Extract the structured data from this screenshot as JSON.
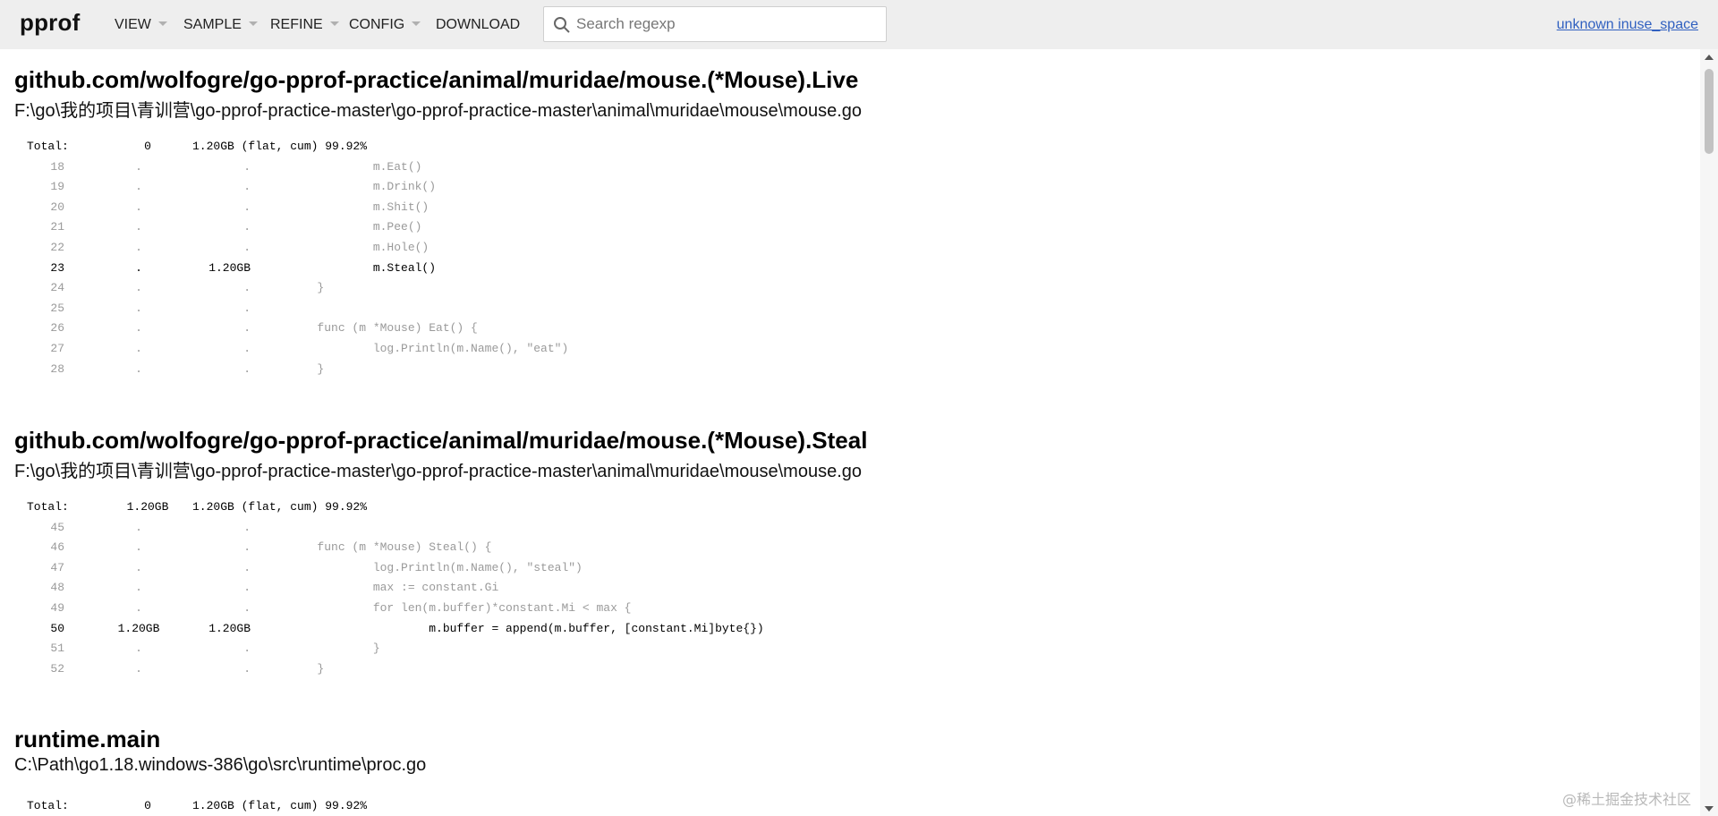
{
  "header": {
    "logo": "pprof",
    "menus": [
      {
        "label": "VIEW"
      },
      {
        "label": "SAMPLE"
      },
      {
        "label": "REFINE"
      },
      {
        "label": "CONFIG"
      },
      {
        "label": "DOWNLOAD"
      }
    ],
    "search_placeholder": "Search regexp",
    "search_value": "",
    "profile_link": "unknown inuse_space"
  },
  "sections": [
    {
      "title": "github.com/wolfogre/go-pprof-practice/animal/muridae/mouse.(*Mouse).Live",
      "path": "F:\\go\\我的项目\\青训营\\go-pprof-practice-master\\go-pprof-practice-master\\animal\\muridae\\mouse\\mouse.go",
      "total": {
        "label": "Total:",
        "flat": "0",
        "rest": "1.20GB (flat, cum) 99.92%"
      },
      "lines": [
        {
          "num": "18",
          "flat": ".",
          "cum": ".",
          "src": "                m.Eat()",
          "hot": false
        },
        {
          "num": "19",
          "flat": ".",
          "cum": ".",
          "src": "                m.Drink()",
          "hot": false
        },
        {
          "num": "20",
          "flat": ".",
          "cum": ".",
          "src": "                m.Shit()",
          "hot": false
        },
        {
          "num": "21",
          "flat": ".",
          "cum": ".",
          "src": "                m.Pee()",
          "hot": false
        },
        {
          "num": "22",
          "flat": ".",
          "cum": ".",
          "src": "                m.Hole()",
          "hot": false
        },
        {
          "num": "23",
          "flat": ".",
          "cum": "1.20GB",
          "src": "                m.Steal()",
          "hot": true
        },
        {
          "num": "24",
          "flat": ".",
          "cum": ".",
          "src": "        }",
          "hot": false
        },
        {
          "num": "25",
          "flat": ".",
          "cum": ".",
          "src": "",
          "hot": false
        },
        {
          "num": "26",
          "flat": ".",
          "cum": ".",
          "src": "        func (m *Mouse) Eat() {",
          "hot": false
        },
        {
          "num": "27",
          "flat": ".",
          "cum": ".",
          "src": "                log.Println(m.Name(), \"eat\")",
          "hot": false
        },
        {
          "num": "28",
          "flat": ".",
          "cum": ".",
          "src": "        }",
          "hot": false
        }
      ]
    },
    {
      "title": "github.com/wolfogre/go-pprof-practice/animal/muridae/mouse.(*Mouse).Steal",
      "path": "F:\\go\\我的项目\\青训营\\go-pprof-practice-master\\go-pprof-practice-master\\animal\\muridae\\mouse\\mouse.go",
      "total": {
        "label": "Total:",
        "flat": "1.20GB",
        "rest": "1.20GB (flat, cum) 99.92%"
      },
      "lines": [
        {
          "num": "45",
          "flat": ".",
          "cum": ".",
          "src": "",
          "hot": false
        },
        {
          "num": "46",
          "flat": ".",
          "cum": ".",
          "src": "        func (m *Mouse) Steal() {",
          "hot": false
        },
        {
          "num": "47",
          "flat": ".",
          "cum": ".",
          "src": "                log.Println(m.Name(), \"steal\")",
          "hot": false
        },
        {
          "num": "48",
          "flat": ".",
          "cum": ".",
          "src": "                max := constant.Gi",
          "hot": false
        },
        {
          "num": "49",
          "flat": ".",
          "cum": ".",
          "src": "                for len(m.buffer)*constant.Mi < max {",
          "hot": false
        },
        {
          "num": "50",
          "flat": "1.20GB",
          "cum": "1.20GB",
          "src": "                        m.buffer = append(m.buffer, [constant.Mi]byte{})",
          "hot": true
        },
        {
          "num": "51",
          "flat": ".",
          "cum": ".",
          "src": "                }",
          "hot": false
        },
        {
          "num": "52",
          "flat": ".",
          "cum": ".",
          "src": "        }",
          "hot": false
        }
      ]
    },
    {
      "title": "runtime.main",
      "path": "C:\\Path\\go1.18.windows-386\\go\\src\\runtime\\proc.go",
      "total": {
        "label": "Total:",
        "flat": "0",
        "rest": "1.20GB (flat, cum) 99.92%"
      },
      "lines": []
    }
  ],
  "watermark": "@稀土掘金技术社区"
}
